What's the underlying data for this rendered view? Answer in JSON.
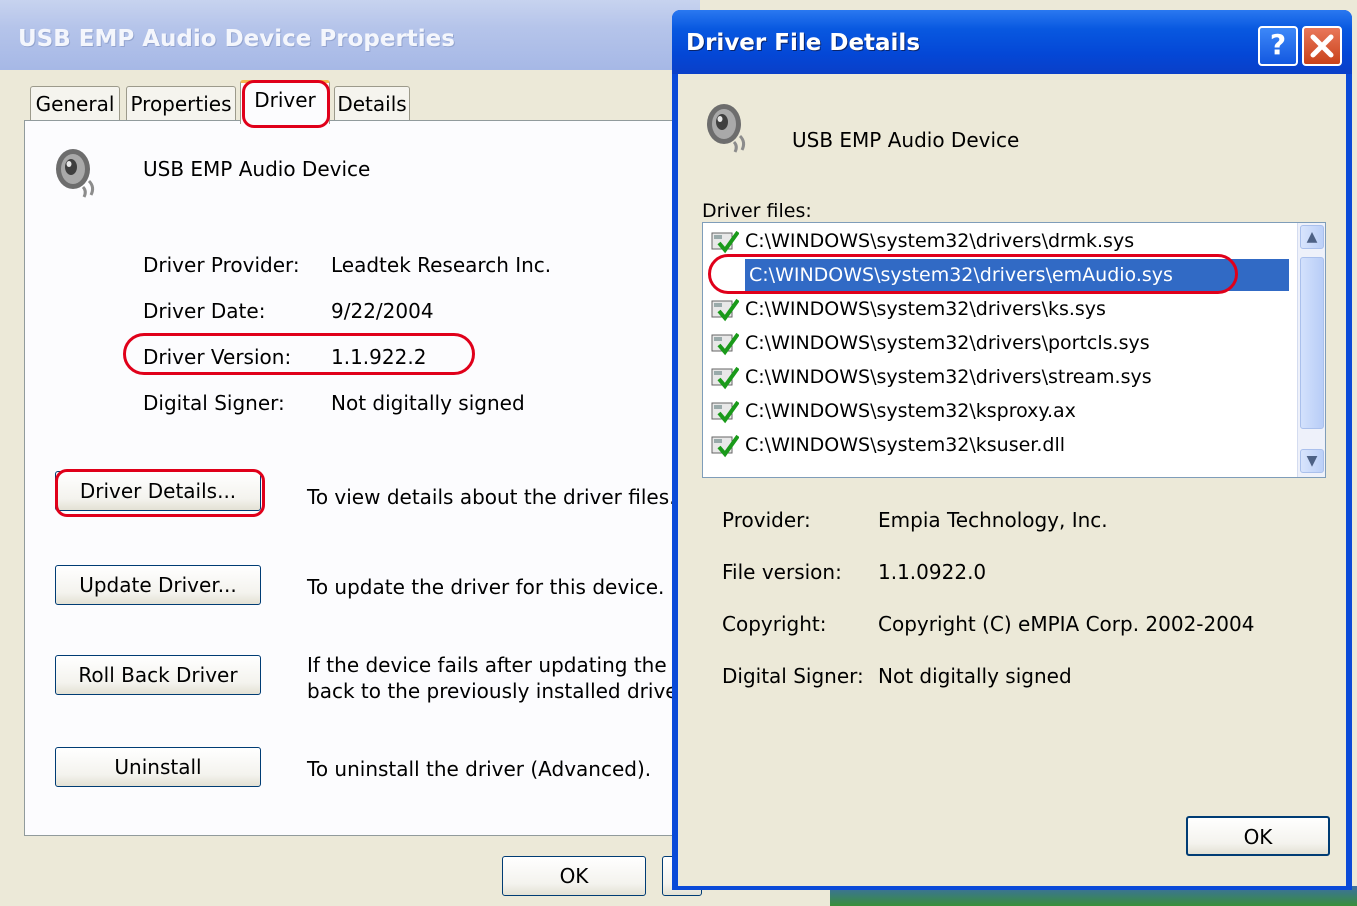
{
  "props_window": {
    "title": "USB EMP Audio Device Properties",
    "tabs": [
      {
        "label": "General"
      },
      {
        "label": "Properties"
      },
      {
        "label": "Driver"
      },
      {
        "label": "Details"
      }
    ],
    "active_tab": "Driver",
    "device_name": "USB EMP Audio Device",
    "fields": [
      {
        "label": "Driver Provider:",
        "value": "Leadtek Research Inc."
      },
      {
        "label": "Driver Date:",
        "value": "9/22/2004"
      },
      {
        "label": "Driver Version:",
        "value": "1.1.922.2"
      },
      {
        "label": "Digital Signer:",
        "value": "Not digitally signed"
      }
    ],
    "actions": [
      {
        "button": "Driver Details...",
        "description": "To view details about the driver files."
      },
      {
        "button": "Update Driver...",
        "description": "To update the driver for this device."
      },
      {
        "button": "Roll Back Driver",
        "description": "If the device fails after updating the driv",
        "description2": "back to the previously installed driver."
      },
      {
        "button": "Uninstall",
        "description": "To uninstall the driver (Advanced)."
      }
    ],
    "ok_label": "OK"
  },
  "dfd_window": {
    "title": "Driver File Details",
    "help_glyph": "?",
    "close_glyph": "✕",
    "device_name": "USB EMP Audio Device",
    "files_label": "Driver files:",
    "files": [
      {
        "path": "C:\\WINDOWS\\system32\\drivers\\drmk.sys",
        "signed": true
      },
      {
        "path": "C:\\WINDOWS\\system32\\drivers\\emAudio.sys",
        "signed": false,
        "selected": true
      },
      {
        "path": "C:\\WINDOWS\\system32\\drivers\\ks.sys",
        "signed": true
      },
      {
        "path": "C:\\WINDOWS\\system32\\drivers\\portcls.sys",
        "signed": true
      },
      {
        "path": "C:\\WINDOWS\\system32\\drivers\\stream.sys",
        "signed": true
      },
      {
        "path": "C:\\WINDOWS\\system32\\ksproxy.ax",
        "signed": true
      },
      {
        "path": "C:\\WINDOWS\\system32\\ksuser.dll",
        "signed": true
      }
    ],
    "details": [
      {
        "label": "Provider:",
        "value": "Empia Technology, Inc."
      },
      {
        "label": "File version:",
        "value": "1.1.0922.0"
      },
      {
        "label": "Copyright:",
        "value": "Copyright (C) eMPIA Corp. 2002-2004"
      },
      {
        "label": "Digital Signer:",
        "value": "Not digitally signed"
      }
    ],
    "ok_label": "OK"
  },
  "colors": {
    "annotation_red": "#e0001a",
    "selection_blue": "#316ac5",
    "title_blue": "#0a4ad8"
  },
  "icons": {
    "device": "speaker-icon",
    "signed_file": "signed-file-icon",
    "scroll_up": "scroll-up-icon",
    "scroll_down": "scroll-down-icon"
  }
}
